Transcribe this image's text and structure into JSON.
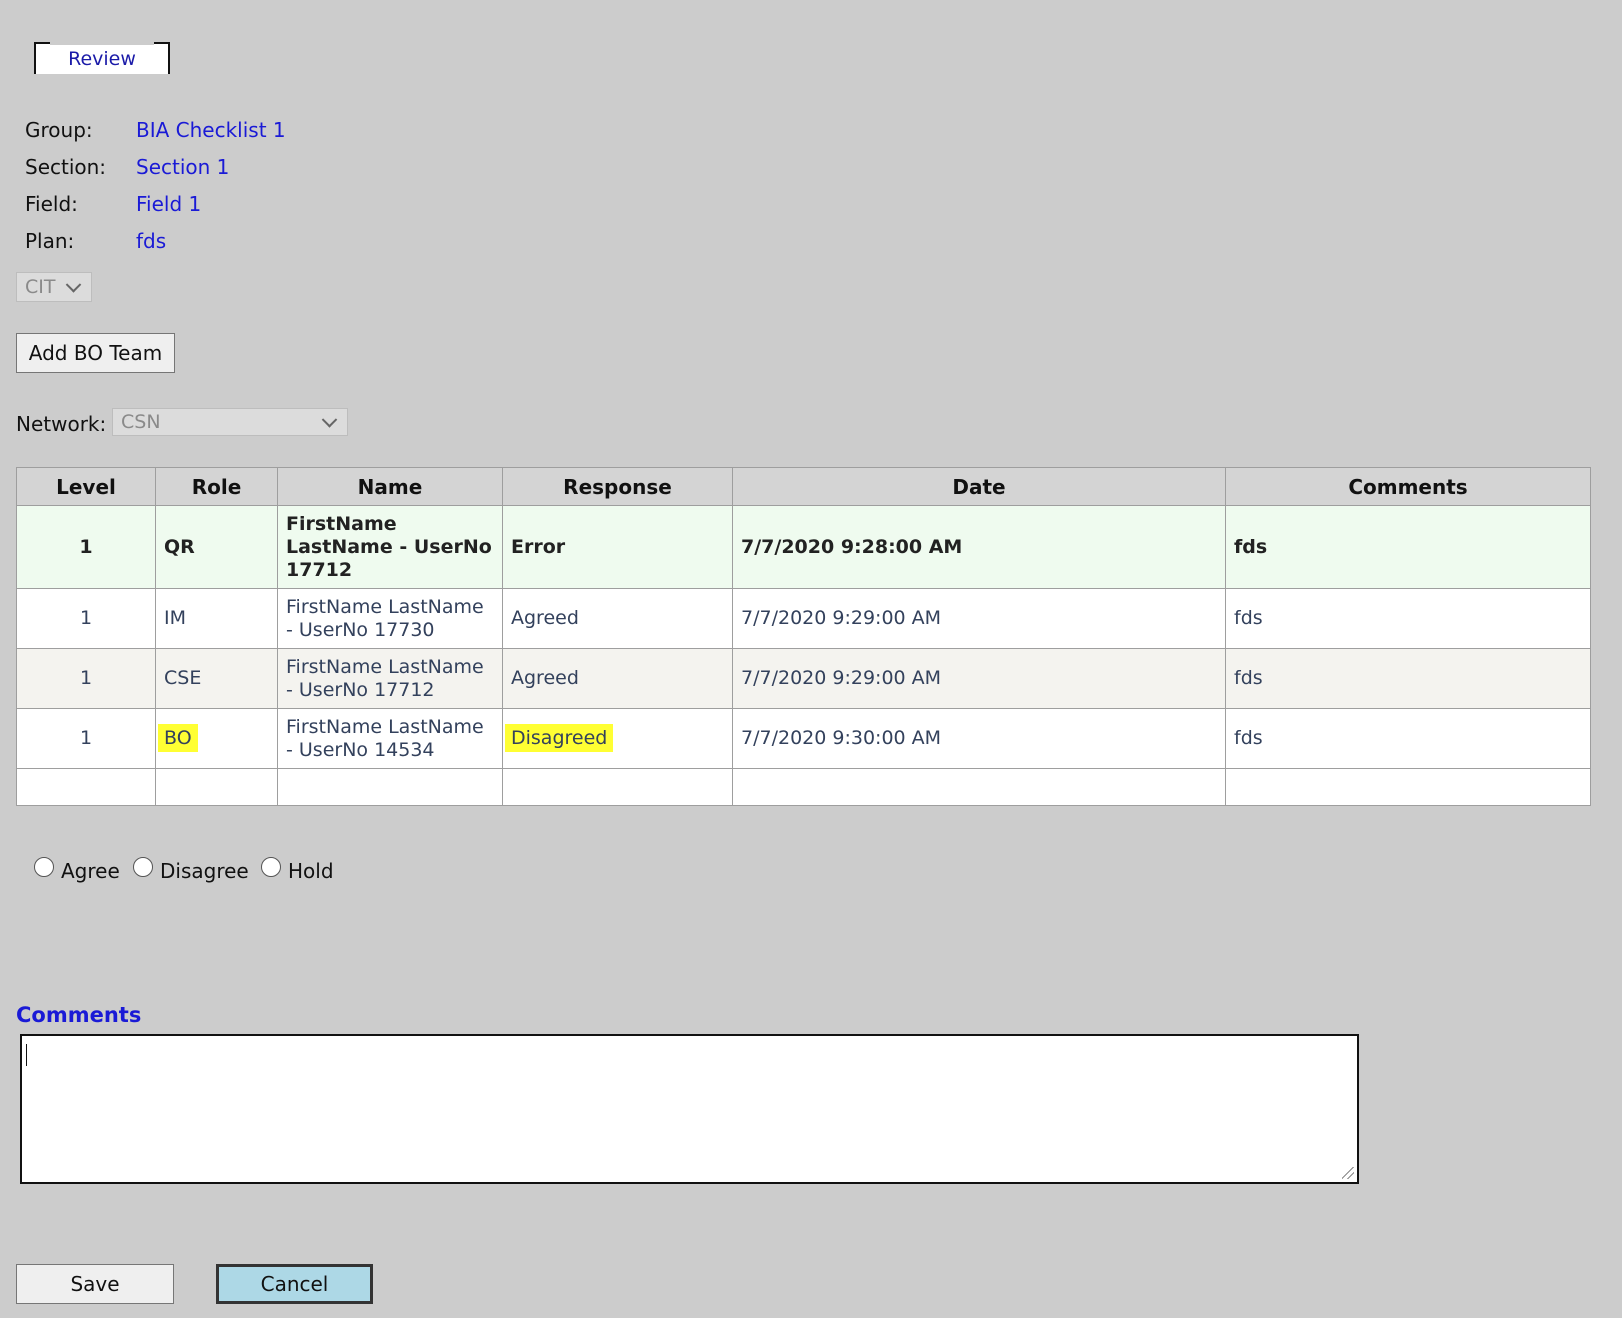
{
  "tab": {
    "label": "Review"
  },
  "info": [
    {
      "label": "Group:",
      "value": "BIA Checklist 1"
    },
    {
      "label": "Section:",
      "value": "Section 1"
    },
    {
      "label": "Field:",
      "value": "Field 1"
    },
    {
      "label": "Plan:",
      "value": "fds"
    }
  ],
  "role_select": {
    "value": "CIT"
  },
  "add_team_button": "Add BO Team",
  "network": {
    "label": "Network:",
    "value": "CSN"
  },
  "table": {
    "headers": [
      "Level",
      "Role",
      "Name",
      "Response",
      "Date",
      "Comments"
    ],
    "rows": [
      {
        "level": "1",
        "role": "QR",
        "name": "FirstName LastName - UserNo 17712",
        "response": "Error",
        "date": "7/7/2020 9:28:00 AM",
        "comments": "fds"
      },
      {
        "level": "1",
        "role": "IM",
        "name": "FirstName LastName - UserNo 17730",
        "response": "Agreed",
        "date": "7/7/2020 9:29:00 AM",
        "comments": "fds"
      },
      {
        "level": "1",
        "role": "CSE",
        "name": "FirstName LastName - UserNo 17712",
        "response": "Agreed",
        "date": "7/7/2020 9:29:00 AM",
        "comments": "fds"
      },
      {
        "level": "1",
        "role": "BO",
        "name": "FirstName LastName - UserNo 14534",
        "response": "Disagreed",
        "date": "7/7/2020 9:30:00 AM",
        "comments": "fds"
      }
    ]
  },
  "radios": [
    "Agree",
    "Disagree",
    "Hold"
  ],
  "comments": {
    "title": "Comments",
    "value": ""
  },
  "buttons": {
    "save": "Save",
    "cancel": "Cancel"
  },
  "colors": {
    "background": "#cccccc",
    "link": "#1a1ad6",
    "highlight": "#ffff33",
    "first_row": "#effbef",
    "cancel_bg": "#add8e6"
  }
}
